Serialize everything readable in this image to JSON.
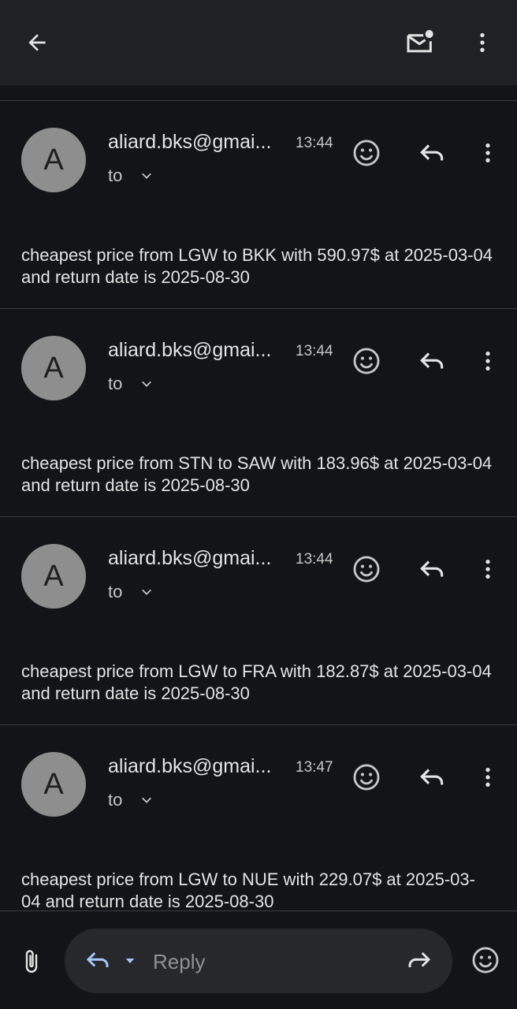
{
  "icons": {
    "back": "arrow-back-icon",
    "unread": "mark-unread-icon",
    "more": "more-vert-icon",
    "emoji": "add-reaction-icon",
    "reply": "reply-icon",
    "chevron": "chevron-down-icon",
    "attach": "attachment-icon",
    "forward": "forward-icon"
  },
  "colors": {
    "background": "#131418",
    "appbar": "#202124",
    "avatar": "#8e8e8e",
    "reply_accent": "#a8c7fa"
  },
  "messages": [
    {
      "avatar_letter": "A",
      "sender": "aliard.bks@gmai...",
      "time": "13:44",
      "to_label": "to",
      "body": "cheapest price from LGW to BKK with 590.97$ at 2025-03-04 and return date is 2025-08-30"
    },
    {
      "avatar_letter": "A",
      "sender": "aliard.bks@gmai...",
      "time": "13:44",
      "to_label": "to",
      "body": "cheapest price from STN to SAW with 183.96$ at 2025-03-04 and return date is 2025-08-30"
    },
    {
      "avatar_letter": "A",
      "sender": "aliard.bks@gmai...",
      "time": "13:44",
      "to_label": "to",
      "body": "cheapest price from LGW to FRA with 182.87$ at 2025-03-04 and return date is 2025-08-30"
    },
    {
      "avatar_letter": "A",
      "sender": "aliard.bks@gmai...",
      "time": "13:47",
      "to_label": "to",
      "body": "cheapest price from LGW to NUE with 229.07$ at 2025-03-04 and return date is 2025-08-30"
    }
  ],
  "reply_bar": {
    "placeholder": "Reply"
  }
}
